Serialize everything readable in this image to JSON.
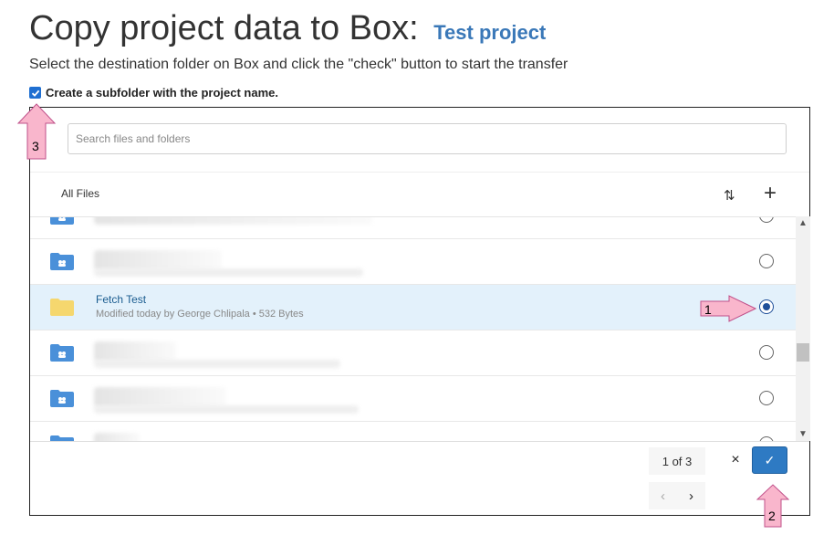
{
  "title": "Copy project data to Box:",
  "project_name": "Test project",
  "subtitle": "Select the destination folder on Box and click the \"check\" button to start the transfer",
  "subfolder_checkbox": {
    "label": "Create a subfolder with the project name.",
    "checked": true
  },
  "search": {
    "placeholder": "Search files and folders",
    "value": ""
  },
  "breadcrumb": "All Files",
  "icons": {
    "sort": "sort-icon",
    "add": "plus-icon",
    "folder": "folder-icon",
    "shared_folder": "shared-folder-icon"
  },
  "items": [
    {
      "name": "",
      "meta": "",
      "type": "shared-folder",
      "selected": false,
      "redacted": true
    },
    {
      "name": "",
      "meta": "",
      "type": "shared-folder",
      "selected": false,
      "redacted": true
    },
    {
      "name": "Fetch Test",
      "meta": "Modified today by George Chlipala • 532 Bytes",
      "type": "folder",
      "selected": true,
      "redacted": false
    },
    {
      "name": "",
      "meta": "",
      "type": "shared-folder",
      "selected": false,
      "redacted": true
    },
    {
      "name": "",
      "meta": "",
      "type": "shared-folder",
      "selected": false,
      "redacted": true
    },
    {
      "name": "",
      "meta": "",
      "type": "shared-folder",
      "selected": false,
      "redacted": true
    }
  ],
  "pagination": {
    "label": "1 of 3",
    "prev": "‹",
    "next": "›"
  },
  "actions": {
    "cancel": "×",
    "confirm": "✓"
  },
  "annotations": [
    {
      "label": "1"
    },
    {
      "label": "2"
    },
    {
      "label": "3"
    }
  ],
  "colors": {
    "accent": "#2e7ac3",
    "selected_row": "#e3f1fb",
    "annotation_arrow": "#f9b6cc",
    "project_link": "#3a78b8"
  }
}
